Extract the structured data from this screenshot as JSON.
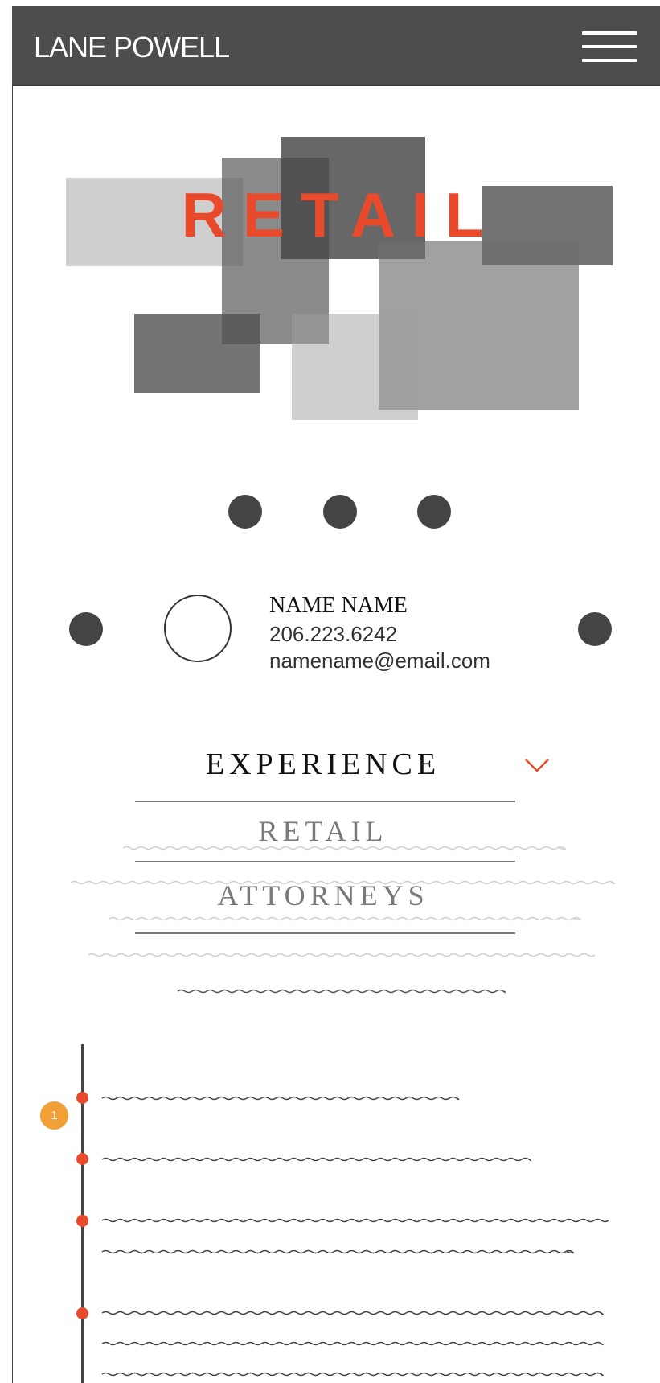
{
  "header": {
    "logo_text": "LANE POWELL",
    "menu_icon": "hamburger-menu-icon"
  },
  "hero": {
    "title": "RETAIL",
    "accent_color": "#e84a2b"
  },
  "contact": {
    "name": "NAME NAME",
    "phone": "206.223.6242",
    "email": "namename@email.com"
  },
  "experience_menu": {
    "title": "EXPERIENCE",
    "toggle_icon": "chevron-down-icon",
    "items": [
      "RETAIL",
      "ATTORNEYS"
    ]
  },
  "timeline": {
    "badge": "1",
    "badge_color": "#f0a035"
  }
}
